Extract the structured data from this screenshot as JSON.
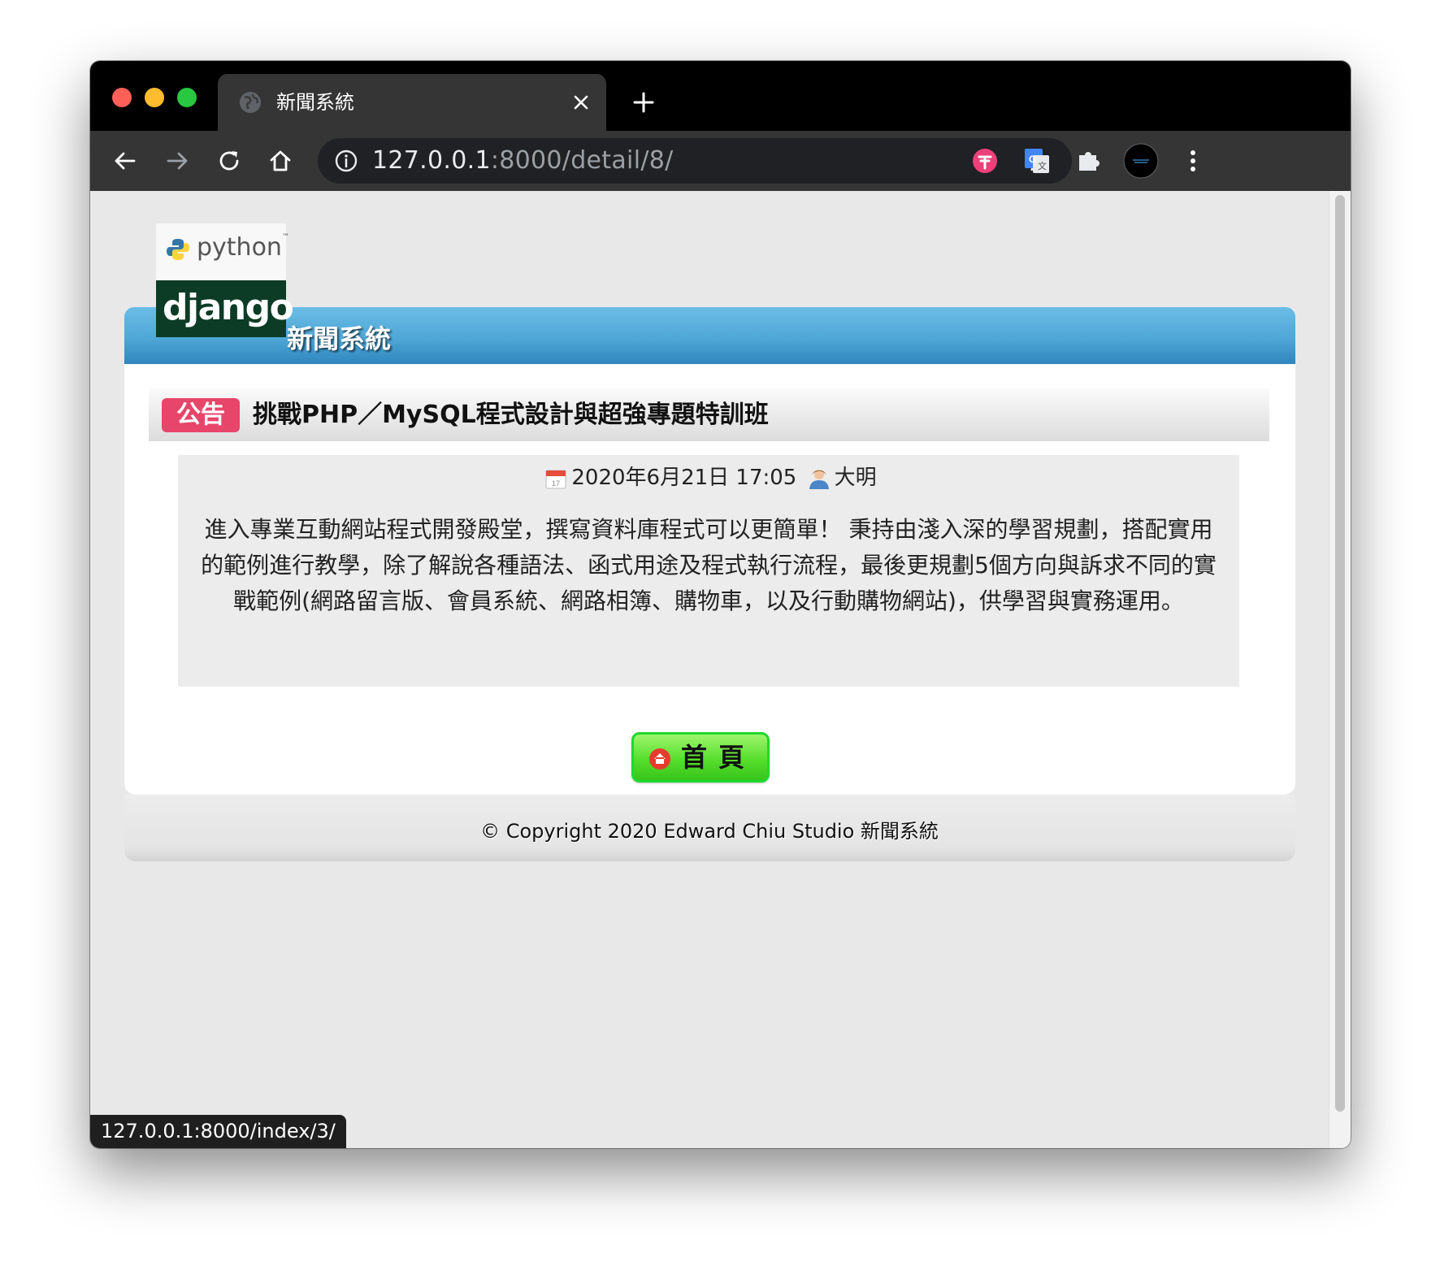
{
  "browser": {
    "tab_title": "新聞系統",
    "url_host": "127.0.0.1",
    "url_rest": ":8000/detail/8/",
    "status_url": "127.0.0.1:8000/index/3/"
  },
  "site": {
    "logo_python": "python",
    "logo_python_tm": "™",
    "logo_django": "django",
    "title": "新聞系統"
  },
  "article": {
    "badge": "公告",
    "title": "挑戰PHP／MySQL程式設計與超強專題特訓班",
    "date": "2020年6月21日 17:05",
    "author": "大明",
    "body": "進入專業互動網站程式開發殿堂，撰寫資料庫程式可以更簡單！ 秉持由淺入深的學習規劃，搭配實用的範例進行教學，除了解說各種語法、函式用途及程式執行流程，最後更規劃5個方向與訴求不同的實戰範例(網路留言版、會員系統、網路相簿、購物車，以及行動購物網站)，供學習與實務運用。"
  },
  "home_button": {
    "label": "首頁"
  },
  "footer": {
    "copyright": "© Copyright 2020 Edward Chiu Studio 新聞系統"
  },
  "colors": {
    "header_blue": "#4ea7d6",
    "badge_red": "#e8456b",
    "button_green": "#57de2d",
    "django_green": "#0c3c26"
  }
}
